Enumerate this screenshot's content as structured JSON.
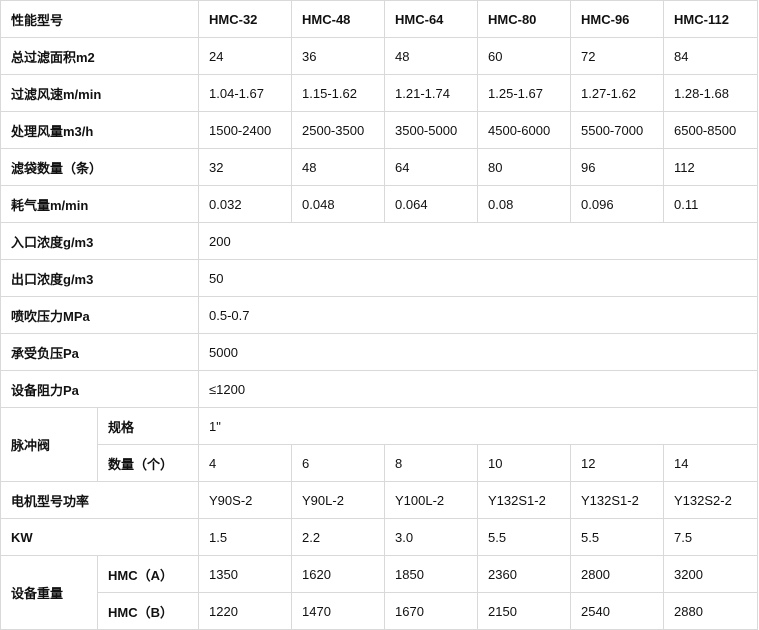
{
  "title": "性能型号",
  "models": [
    "HMC-32",
    "HMC-48",
    "HMC-64",
    "HMC-80",
    "HMC-96",
    "HMC-112"
  ],
  "rows": {
    "filter_area": {
      "label": "总过滤面积m2",
      "values": [
        "24",
        "36",
        "48",
        "60",
        "72",
        "84"
      ]
    },
    "filter_speed": {
      "label": "过滤风速m/min",
      "values": [
        "1.04-1.67",
        "1.15-1.62",
        "1.21-1.74",
        "1.25-1.67",
        "1.27-1.62",
        "1.28-1.68"
      ]
    },
    "air_volume": {
      "label": "处理风量m3/h",
      "values": [
        "1500-2400",
        "2500-3500",
        "3500-5000",
        "4500-6000",
        "5500-7000",
        "6500-8500"
      ]
    },
    "bag_count": {
      "label": "滤袋数量（条）",
      "values": [
        "32",
        "48",
        "64",
        "80",
        "96",
        "112"
      ]
    },
    "air_consumption": {
      "label": "耗气量m/min",
      "values": [
        "0.032",
        "0.048",
        "0.064",
        "0.08",
        "0.096",
        "0.11"
      ]
    },
    "inlet_conc": {
      "label": "入口浓度g/m3",
      "value": "200"
    },
    "outlet_conc": {
      "label": "出口浓度g/m3",
      "value": "50"
    },
    "blow_pressure": {
      "label": "喷吹压力MPa",
      "value": "0.5-0.7"
    },
    "neg_pressure": {
      "label": "承受负压Pa",
      "value": "5000"
    },
    "resistance": {
      "label": "设备阻力Pa",
      "value": "≤1200"
    },
    "pulse_valve": {
      "label": "脉冲阀",
      "spec": {
        "label": "规格",
        "value": "1\""
      },
      "count": {
        "label": "数量（个）",
        "values": [
          "4",
          "6",
          "8",
          "10",
          "12",
          "14"
        ]
      }
    },
    "motor": {
      "label": "电机型号功率",
      "values": [
        "Y90S-2",
        "Y90L-2",
        "Y100L-2",
        "Y132S1-2",
        "Y132S1-2",
        "Y132S2-2"
      ]
    },
    "kw": {
      "label": "KW",
      "values": [
        "1.5",
        "2.2",
        "3.0",
        "5.5",
        "5.5",
        "7.5"
      ]
    },
    "weight": {
      "label": "设备重量",
      "a": {
        "label": "HMC（A）",
        "values": [
          "1350",
          "1620",
          "1850",
          "2360",
          "2800",
          "3200"
        ]
      },
      "b": {
        "label": "HMC（B）",
        "values": [
          "1220",
          "1470",
          "1670",
          "2150",
          "2540",
          "2880"
        ]
      }
    }
  }
}
